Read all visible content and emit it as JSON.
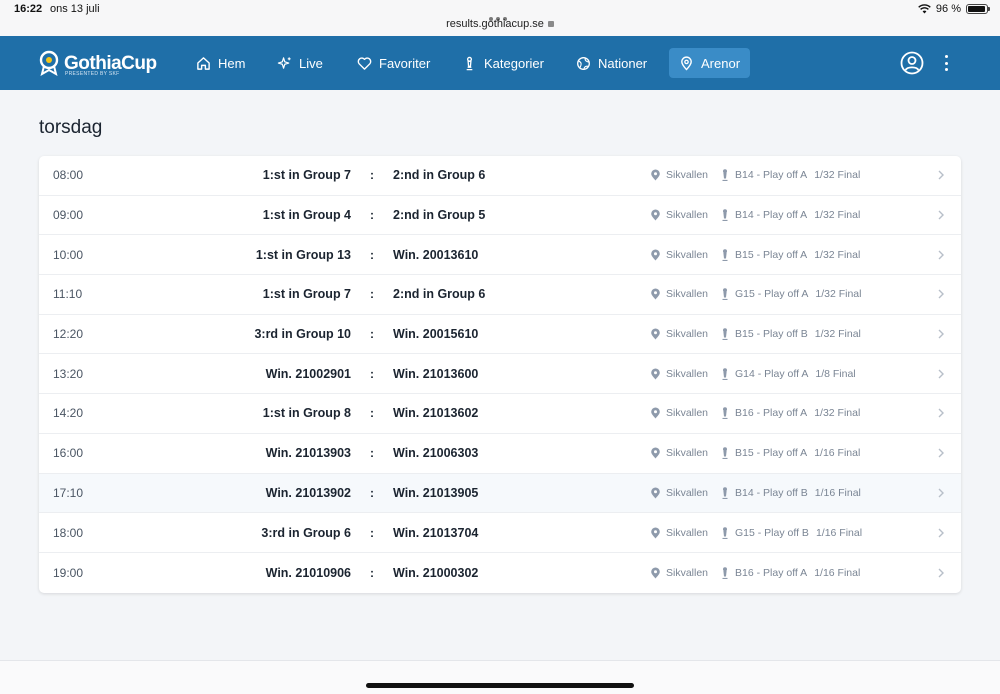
{
  "status_bar": {
    "time": "16:22",
    "date": "ons 13 juli",
    "url": "results.gothiacup.se",
    "battery": "96 %",
    "battery_level": 0.96
  },
  "navbar": {
    "logo": "GothiaCup",
    "logo_sub": "PRESENTED BY SKF",
    "items": [
      {
        "label": "Hem",
        "icon": "home-icon"
      },
      {
        "label": "Live",
        "icon": "sparkle-icon"
      },
      {
        "label": "Favoriter",
        "icon": "heart-icon"
      },
      {
        "label": "Kategorier",
        "icon": "trophy-icon"
      },
      {
        "label": "Nationer",
        "icon": "globe-icon"
      },
      {
        "label": "Arenor",
        "icon": "location-pin-icon",
        "active": true
      }
    ],
    "accent": "#1f6fa8",
    "active_bg": "#3a8cc7"
  },
  "day_title": "torsdag",
  "matches": [
    {
      "time": "08:00",
      "home": "1:st in Group 7",
      "sep": ":",
      "away": "2:nd in Group 6",
      "venue": "Sikvallen",
      "category": "B14 - Play off A",
      "round": "1/32 Final"
    },
    {
      "time": "09:00",
      "home": "1:st in Group 4",
      "sep": ":",
      "away": "2:nd in Group 5",
      "venue": "Sikvallen",
      "category": "B14 - Play off A",
      "round": "1/32 Final"
    },
    {
      "time": "10:00",
      "home": "1:st in Group 13",
      "sep": ":",
      "away": "Win. 20013610",
      "venue": "Sikvallen",
      "category": "B15 - Play off A",
      "round": "1/32 Final"
    },
    {
      "time": "11:10",
      "home": "1:st in Group 7",
      "sep": ":",
      "away": "2:nd in Group 6",
      "venue": "Sikvallen",
      "category": "G15 - Play off A",
      "round": "1/32 Final"
    },
    {
      "time": "12:20",
      "home": "3:rd in Group 10",
      "sep": ":",
      "away": "Win. 20015610",
      "venue": "Sikvallen",
      "category": "B15 - Play off B",
      "round": "1/32 Final"
    },
    {
      "time": "13:20",
      "home": "Win. 21002901",
      "sep": ":",
      "away": "Win. 21013600",
      "venue": "Sikvallen",
      "category": "G14 - Play off A",
      "round": "1/8 Final"
    },
    {
      "time": "14:20",
      "home": "1:st in Group 8",
      "sep": ":",
      "away": "Win. 21013602",
      "venue": "Sikvallen",
      "category": "B16 - Play off A",
      "round": "1/32 Final"
    },
    {
      "time": "16:00",
      "home": "Win. 21013903",
      "sep": ":",
      "away": "Win. 21006303",
      "venue": "Sikvallen",
      "category": "B15 - Play off A",
      "round": "1/16 Final"
    },
    {
      "time": "17:10",
      "home": "Win. 21013902",
      "sep": ":",
      "away": "Win. 21013905",
      "venue": "Sikvallen",
      "category": "B14 - Play off B",
      "round": "1/16 Final",
      "highlighted": true
    },
    {
      "time": "18:00",
      "home": "3:rd in Group 6",
      "sep": ":",
      "away": "Win. 21013704",
      "venue": "Sikvallen",
      "category": "G15 - Play off B",
      "round": "1/16 Final"
    },
    {
      "time": "19:00",
      "home": "Win. 21010906",
      "sep": ":",
      "away": "Win. 21000302",
      "venue": "Sikvallen",
      "category": "B16 - Play off A",
      "round": "1/16 Final"
    }
  ]
}
